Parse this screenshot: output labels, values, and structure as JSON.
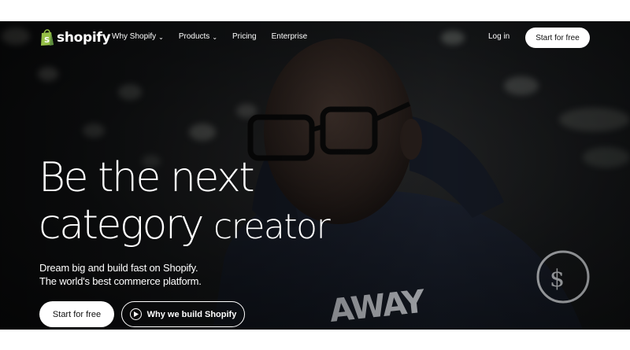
{
  "nav": {
    "logo_text": "shopify",
    "links": [
      {
        "label": "Why Shopify",
        "has_dropdown": true
      },
      {
        "label": "Products",
        "has_dropdown": true
      },
      {
        "label": "Pricing",
        "has_dropdown": false
      },
      {
        "label": "Enterprise",
        "has_dropdown": false
      }
    ],
    "login": "Log in",
    "cta": "Start for free"
  },
  "hero": {
    "headline_line1": "Be the next",
    "headline_line2_a": "category",
    "headline_line2_b": "creator",
    "sub_line1": "Dream big and build fast on Shopify.",
    "sub_line2": "The world's best commerce platform.",
    "cta_primary": "Start for free",
    "cta_secondary": "Why we build Shopify"
  },
  "icons": {
    "logo": "shopify-bag-icon",
    "dropdown": "chevron-down-icon",
    "play": "play-icon"
  },
  "colors": {
    "logo_green": "#95bf47",
    "logo_green_dark": "#5e8e3e",
    "text": "#ffffff",
    "button_bg": "#ffffff",
    "button_text": "#111111"
  }
}
